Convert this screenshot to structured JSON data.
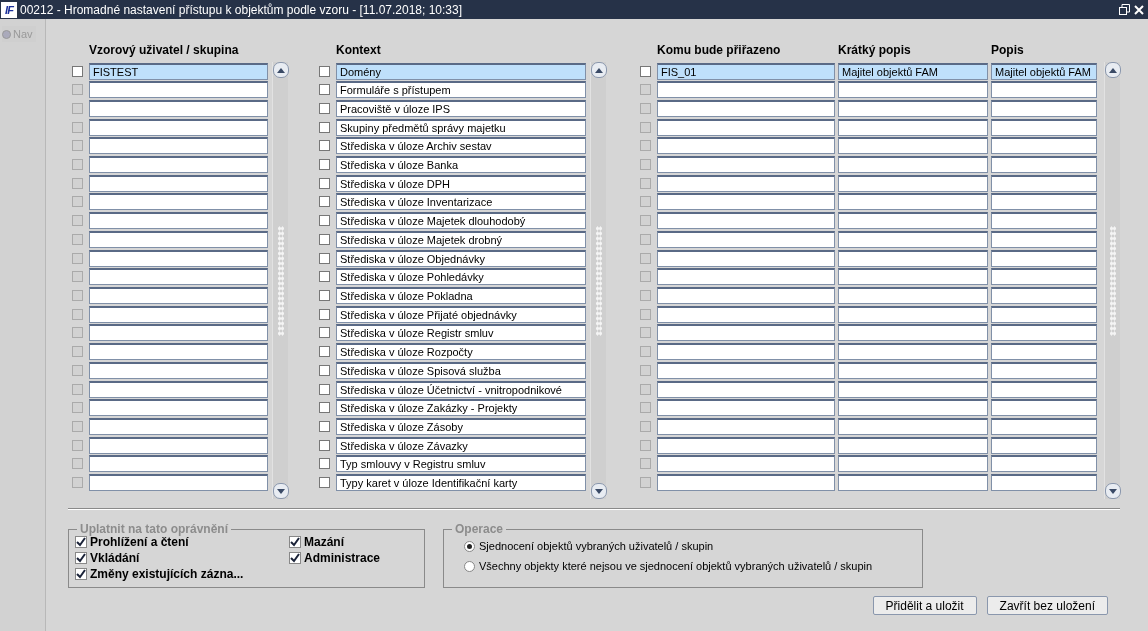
{
  "window": {
    "logo": "IF",
    "title": "00212 -  Hromadné nastavení přístupu k objektům podle vzoru - [11.07.2018; 10:33]"
  },
  "nav": {
    "label": "Nav",
    "disabled": true
  },
  "users": {
    "heading": "Vzorový uživatel / skupina",
    "rows": [
      {
        "value": "FISTEST",
        "selected": true,
        "disabled": false
      },
      {
        "selected": false,
        "disabled": true
      },
      {
        "selected": false,
        "disabled": true
      },
      {
        "selected": false,
        "disabled": true
      },
      {
        "selected": false,
        "disabled": true
      },
      {
        "selected": false,
        "disabled": true
      },
      {
        "selected": false,
        "disabled": true
      },
      {
        "selected": false,
        "disabled": true
      },
      {
        "selected": false,
        "disabled": true
      },
      {
        "selected": false,
        "disabled": true
      },
      {
        "selected": false,
        "disabled": true
      },
      {
        "selected": false,
        "disabled": true
      },
      {
        "selected": false,
        "disabled": true
      },
      {
        "selected": false,
        "disabled": true
      },
      {
        "selected": false,
        "disabled": true
      },
      {
        "selected": false,
        "disabled": true
      },
      {
        "selected": false,
        "disabled": true
      },
      {
        "selected": false,
        "disabled": true
      },
      {
        "selected": false,
        "disabled": true
      },
      {
        "selected": false,
        "disabled": true
      },
      {
        "selected": false,
        "disabled": true
      },
      {
        "selected": false,
        "disabled": true
      },
      {
        "selected": false,
        "disabled": true
      }
    ]
  },
  "context": {
    "heading": "Kontext",
    "rows": [
      {
        "value": "Domény",
        "selected": true,
        "checked": false
      },
      {
        "value": "Formuláře s přístupem",
        "selected": false,
        "checked": false
      },
      {
        "value": "Pracoviště v úloze IPS",
        "selected": false,
        "checked": false
      },
      {
        "value": "Skupiny předmětů správy majetku",
        "selected": false,
        "checked": false
      },
      {
        "value": "Střediska v úloze Archiv sestav",
        "selected": false,
        "checked": false
      },
      {
        "value": "Střediska v úloze Banka",
        "selected": false,
        "checked": false
      },
      {
        "value": "Střediska v úloze DPH",
        "selected": false,
        "checked": false
      },
      {
        "value": "Střediska v úloze Inventarizace",
        "selected": false,
        "checked": false
      },
      {
        "value": "Střediska v úloze Majetek dlouhodobý",
        "selected": false,
        "checked": false
      },
      {
        "value": "Střediska v úloze Majetek drobný",
        "selected": false,
        "checked": false
      },
      {
        "value": "Střediska v úloze Objednávky",
        "selected": false,
        "checked": false
      },
      {
        "value": "Střediska v úloze Pohledávky",
        "selected": false,
        "checked": false
      },
      {
        "value": "Střediska v úloze Pokladna",
        "selected": false,
        "checked": false
      },
      {
        "value": "Střediska v úloze Přijaté objednávky",
        "selected": false,
        "checked": false
      },
      {
        "value": "Střediska v úloze Registr smluv",
        "selected": false,
        "checked": false
      },
      {
        "value": "Střediska v úloze Rozpočty",
        "selected": false,
        "checked": false
      },
      {
        "value": "Střediska v úloze Spisová služba",
        "selected": false,
        "checked": false
      },
      {
        "value": "Střediska v úloze Účetnictví - vnitropodnikové",
        "selected": false,
        "checked": false
      },
      {
        "value": "Střediska v úloze Zakázky - Projekty",
        "selected": false,
        "checked": false
      },
      {
        "value": "Střediska v úloze Zásoby",
        "selected": false,
        "checked": false
      },
      {
        "value": "Střediska v úloze Závazky",
        "selected": false,
        "checked": false
      },
      {
        "value": "Typ smlouvy v Registru smluv",
        "selected": false,
        "checked": false
      },
      {
        "value": "Typy karet v úloze Identifikační karty",
        "selected": false,
        "checked": false
      }
    ]
  },
  "targets": {
    "columns": [
      "Komu bude přiřazeno",
      "Krátký popis",
      "Popis"
    ],
    "rows": [
      {
        "cells": [
          "FIS_01",
          "Majitel objektů FAM",
          "Majitel objektů FAM"
        ],
        "selected": true,
        "disabled": false
      },
      {
        "selected": false,
        "disabled": true
      },
      {
        "selected": false,
        "disabled": true
      },
      {
        "selected": false,
        "disabled": true
      },
      {
        "selected": false,
        "disabled": true
      },
      {
        "selected": false,
        "disabled": true
      },
      {
        "selected": false,
        "disabled": true
      },
      {
        "selected": false,
        "disabled": true
      },
      {
        "selected": false,
        "disabled": true
      },
      {
        "selected": false,
        "disabled": true
      },
      {
        "selected": false,
        "disabled": true
      },
      {
        "selected": false,
        "disabled": true
      },
      {
        "selected": false,
        "disabled": true
      },
      {
        "selected": false,
        "disabled": true
      },
      {
        "selected": false,
        "disabled": true
      },
      {
        "selected": false,
        "disabled": true
      },
      {
        "selected": false,
        "disabled": true
      },
      {
        "selected": false,
        "disabled": true
      },
      {
        "selected": false,
        "disabled": true
      },
      {
        "selected": false,
        "disabled": true
      },
      {
        "selected": false,
        "disabled": true
      },
      {
        "selected": false,
        "disabled": true
      },
      {
        "selected": false,
        "disabled": true
      }
    ]
  },
  "permissions": {
    "title": "Uplatnit na tato oprávnění",
    "items": [
      {
        "label": "Prohlížení a čtení",
        "checked": true
      },
      {
        "label": "Vkládání",
        "checked": true
      },
      {
        "label": "Změny existujících zázna...",
        "checked": true
      },
      {
        "label": "Mazání",
        "checked": true
      },
      {
        "label": "Administrace",
        "checked": true
      }
    ]
  },
  "operation": {
    "title": "Operace",
    "options": [
      {
        "label": "Sjednocení objektů vybraných uživatelů / skupin",
        "selected": true
      },
      {
        "label": "Všechny objekty které nejsou ve sjednocení objektů vybraných uživatelů / skupin",
        "selected": false
      }
    ]
  },
  "buttons": [
    "Přidělit a uložit",
    "Zavřít bez uložení"
  ]
}
